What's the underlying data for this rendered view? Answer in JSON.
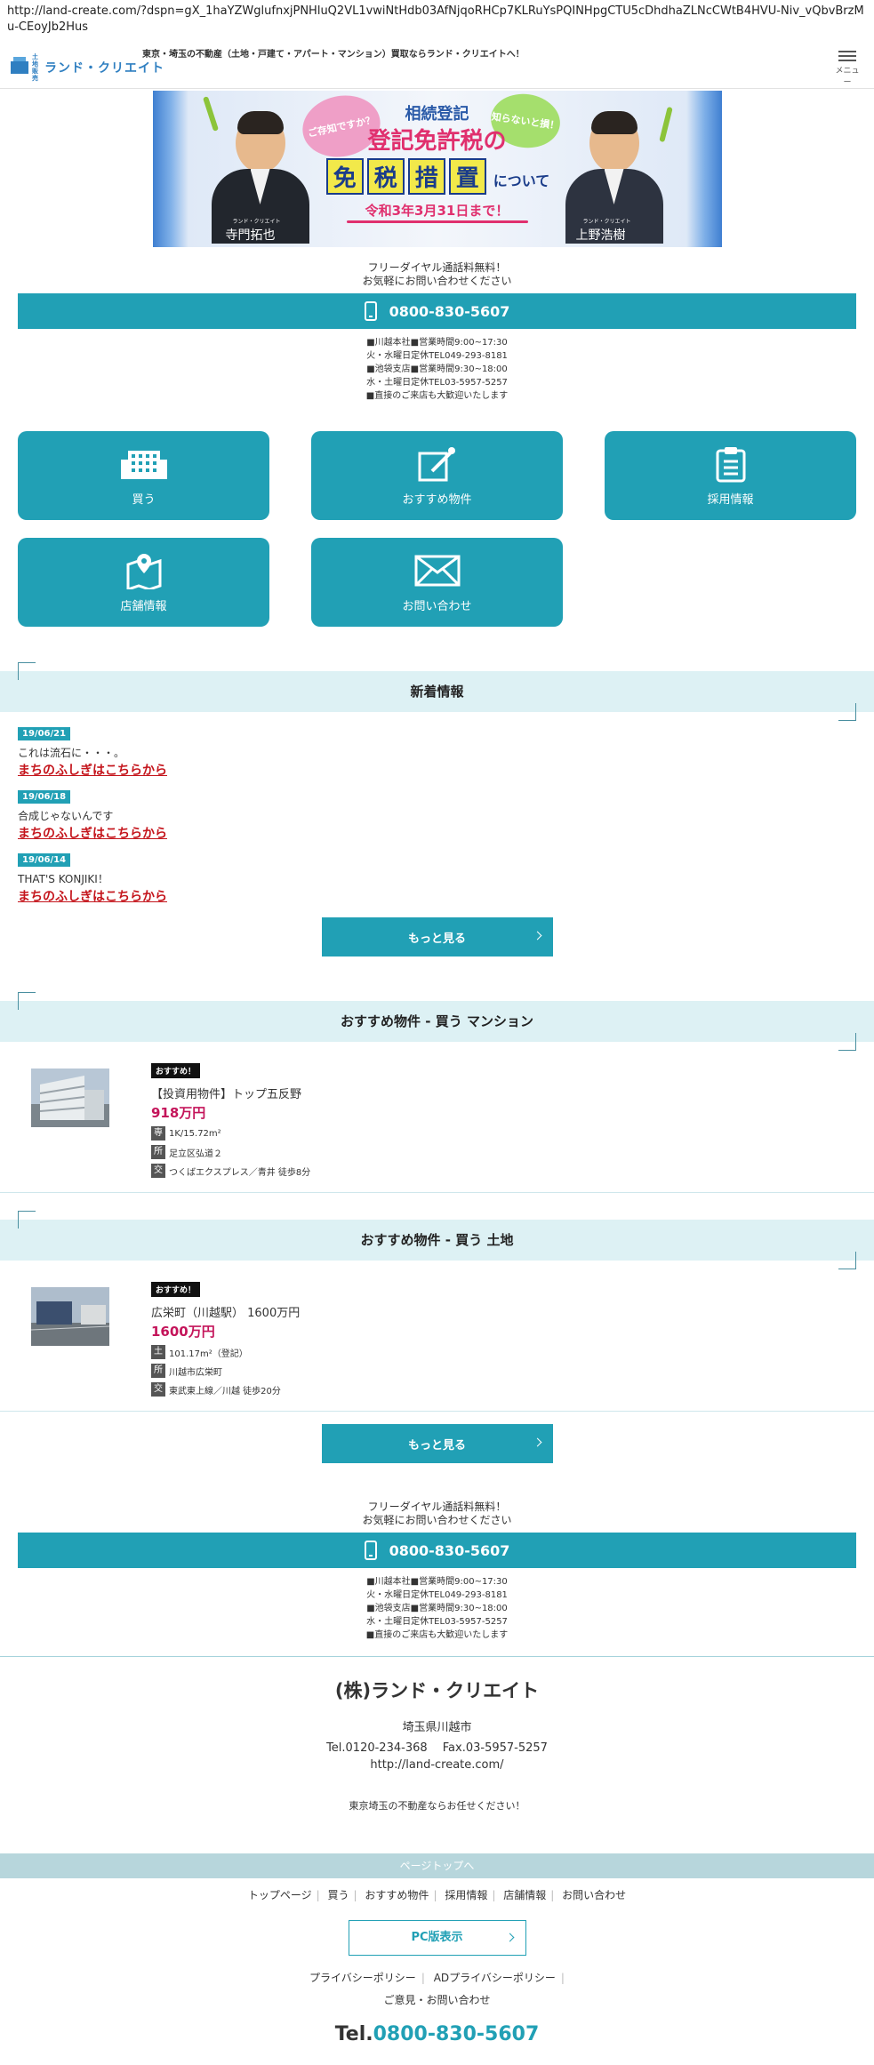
{
  "browser": {
    "url": "http://land-create.com/?dspn=gX_1haYZWglufnxjPNHluQ2VL1vwiNtHdb03AfNjqoRHCp7KLRuYsPQINHpgCTU5cDhdhaZLNcCWtB4HVU-Niv_vQbvBrzMu-CEoyJb2Hus"
  },
  "header": {
    "logo_small": "土地販売",
    "logo_text": "ランド・クリエイト",
    "tagline": "東京・埼玉の不動産（土地・戸建て・アパート・マンション）買取ならランド・クリエイトへ！",
    "menu_label": "メニュー"
  },
  "banner": {
    "bubble_left": "ご存知ですか？",
    "bubble_right": "知らないと損！",
    "line1": "相続登記",
    "line2": "登記免許税の",
    "badges": [
      "免",
      "税",
      "措",
      "置"
    ],
    "badge_suffix": "について",
    "deadline": "令和3年3月31日まで！",
    "person_left_company": "ランド・クリエイト",
    "person_left_name": "寺門拓也",
    "person_right_company": "ランド・クリエイト",
    "person_right_name": "上野浩樹"
  },
  "contact_top": {
    "note1": "フリーダイヤル通話料無料！",
    "note2": "お気軽にお問い合わせください",
    "tel": "0800-830-5607",
    "hours": [
      "■川越本社■営業時間9:00~17:30",
      "火・水曜日定休TEL049-293-8181",
      "■池袋支店■営業時間9:30~18:00",
      "水・土曜日定休TEL03-5957-5257",
      "■直接のご来店も大歓迎いたします"
    ]
  },
  "tiles": [
    {
      "label": "買う",
      "icon": "building-icon"
    },
    {
      "label": "おすすめ物件",
      "icon": "edit-icon"
    },
    {
      "label": "採用情報",
      "icon": "clipboard-icon"
    },
    {
      "label": "店舗情報",
      "icon": "map-pin-icon"
    },
    {
      "label": "お問い合わせ",
      "icon": "mail-icon"
    }
  ],
  "news": {
    "title": "新着情報",
    "items": [
      {
        "date": "19/06/21",
        "title": "これは流石に・・・。",
        "link": "まちのふしぎはこちらから"
      },
      {
        "date": "19/06/18",
        "title": "合成じゃないんです",
        "link": "まちのふしぎはこちらから"
      },
      {
        "date": "19/06/14",
        "title": "THAT'S KONJIKI！",
        "link": "まちのふしぎはこちらから"
      }
    ],
    "more": "もっと見る"
  },
  "recommend_mansion": {
    "title": "おすすめ物件 - 買う マンション",
    "badge": "おすすめ！",
    "name": "【投資用物件】トップ五反野",
    "price": "918万円",
    "spec_labels": [
      "専",
      "所",
      "交"
    ],
    "specs": [
      "1K/15.72m²",
      "足立区弘道２",
      "つくばエクスプレス／青井 徒歩8分"
    ]
  },
  "recommend_land": {
    "title": "おすすめ物件 - 買う 土地",
    "badge": "おすすめ！",
    "name": "広栄町（川越駅） 1600万円",
    "price": "1600万円",
    "spec_labels": [
      "土",
      "所",
      "交"
    ],
    "specs": [
      "101.17m²（登記）",
      "川越市広栄町",
      "東武東上線／川越 徒歩20分"
    ],
    "more": "もっと見る"
  },
  "contact_bottom": {
    "note1": "フリーダイヤル通話料無料！",
    "note2": "お気軽にお問い合わせください",
    "tel": "0800-830-5607",
    "hours": [
      "■川越本社■営業時間9:00~17:30",
      "火・水曜日定休TEL049-293-8181",
      "■池袋支店■営業時間9:30~18:00",
      "水・土曜日定休TEL03-5957-5257",
      "■直接のご来店も大歓迎いたします"
    ]
  },
  "company": {
    "name": "(株)ランド・クリエイト",
    "address": "埼玉県川越市",
    "tel_fax": "Tel.0120-234-368　 Fax.03-5957-5257",
    "url": "http://land-create.com/",
    "tagline": "東京埼玉の不動産ならお任せください！"
  },
  "footer": {
    "pagetop": "ページトップへ",
    "nav": [
      "トップページ",
      "買う",
      "おすすめ物件",
      "採用情報",
      "店舗情報",
      "お問い合わせ"
    ],
    "pc_button": "PC版表示",
    "links": [
      "プライバシーポリシー",
      "ADプライバシーポリシー"
    ],
    "feedback": "ご意見・お問い合わせ",
    "tel_prefix": "Tel.",
    "tel": "0800-830-5607"
  },
  "colors": {
    "accent": "#21a0b5",
    "link_red": "#c4141b",
    "price": "#c4145a",
    "section_bg": "#ddf1f4"
  }
}
